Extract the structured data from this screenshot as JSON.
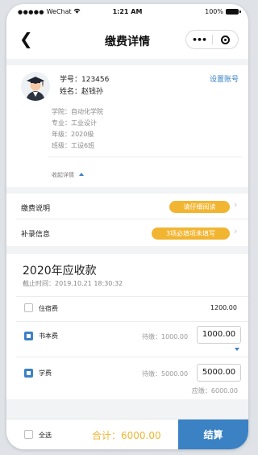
{
  "status_bar": {
    "dots": "●●●●●",
    "carrier": "WeChat",
    "wifi_icon": "wifi-icon",
    "time": "1:21 AM",
    "battery": "100%"
  },
  "nav": {
    "back_glyph": "❮",
    "title": "缴费详情",
    "more_glyph": "•••"
  },
  "student": {
    "id_line": "学号：123456",
    "name_line": "姓名：赵钱孙",
    "settings_link": "设置账号",
    "college": "学院：自动化学院",
    "major": "专业：工业设计",
    "grade": "年级：2020级",
    "class": "班级：工设6班",
    "collapse_label": "收起详情"
  },
  "rows": {
    "payment_note_label": "缴费说明",
    "payment_note_button": "请仔细阅读",
    "supplement_label": "补录信息",
    "supplement_button": "3项必填项未填写",
    "chevron": "›"
  },
  "fees": {
    "year_title": "2020年应收款",
    "deadline": "截止时间：2019.10.21 18:30:32",
    "items": [
      {
        "name": "住宿费",
        "amount": "1200.00",
        "checked": false
      },
      {
        "name": "书本费",
        "pending": "待缴：1000.00",
        "input_value": "1000.00",
        "checked": true
      },
      {
        "name": "学费",
        "pending": "待缴：5000.00",
        "input_value": "5000.00",
        "due": "应缴：6000.00",
        "checked": true
      }
    ]
  },
  "footer": {
    "select_all": "全选",
    "total": "合计：6000.00",
    "checkout": "结算"
  },
  "colors": {
    "accent_blue": "#3b82c4",
    "accent_orange": "#f2b532",
    "background": "#f2f3f5"
  }
}
